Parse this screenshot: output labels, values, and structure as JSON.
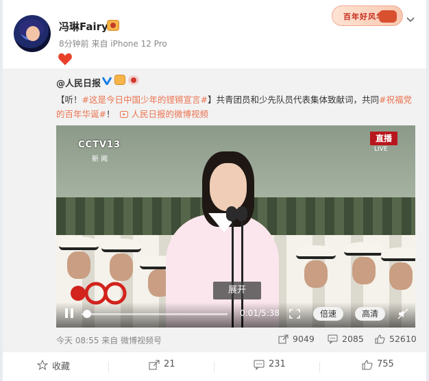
{
  "post": {
    "username": "冯琳Fairy",
    "meta": "8分钟前 来自 iPhone 12 Pro",
    "banner_text": "百年好风华"
  },
  "repost": {
    "user": "@人民日报",
    "text_open": "【听！",
    "hashtag1": "#这是今日中国少年的铿锵宣言#",
    "text_mid": "】共青团员和少先队员代表集体致献词，共同",
    "hashtag2": "#祝福党的百年华诞#",
    "text_end": "！",
    "link": "人民日报的微博视频",
    "video": {
      "channel": "CCTV13",
      "channel_sub": "新 闻",
      "live": "直播",
      "live_sub": "LIVE",
      "expand": "展开",
      "time": "0:01/5:38",
      "progress": 0.0,
      "speed_label": "倍速",
      "quality_label": "高清"
    },
    "footer": {
      "time_source": "今天 08:55 来自 微博视频号",
      "reposts": "9049",
      "comments": "2085",
      "likes": "52610"
    }
  },
  "actions": {
    "collect": "收藏",
    "repost": "21",
    "comment": "231",
    "like": "755"
  },
  "colors": {
    "accent": "#eb7350",
    "live_red": "#b8171d"
  }
}
